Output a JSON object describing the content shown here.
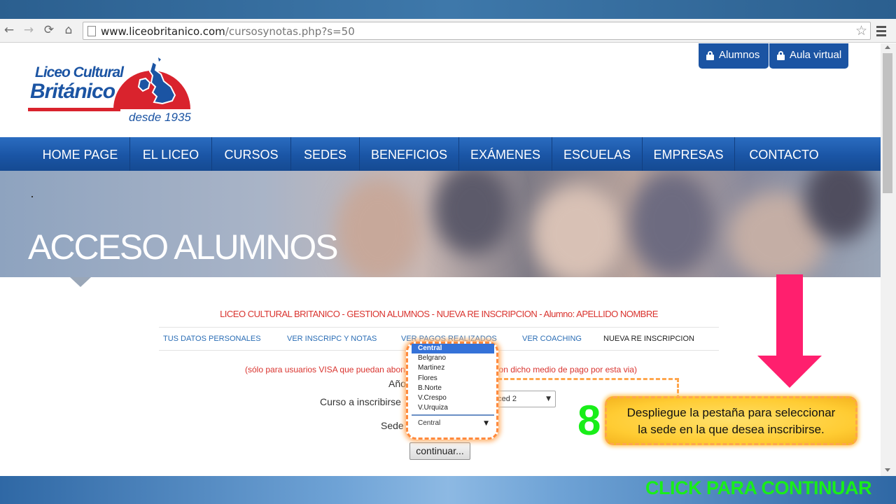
{
  "browser": {
    "url_domain": "www.liceobritanico.com",
    "url_path": "/cursosynotas.php?s=50",
    "back_icon": "←",
    "forward_icon": "→",
    "reload_icon": "⟳",
    "home_icon": "⌂",
    "star_icon": "☆"
  },
  "logo": {
    "line1": "Liceo Cultural",
    "line2": "Británico",
    "tagline": "desde 1935"
  },
  "top_buttons": {
    "students": "Alumnos",
    "virtual": "Aula virtual"
  },
  "nav": {
    "items": [
      "HOME PAGE",
      "EL LICEO",
      "CURSOS",
      "SEDES",
      "BENEFICIOS",
      "EXÁMENES",
      "ESCUELAS",
      "EMPRESAS",
      "CONTACTO"
    ]
  },
  "hero": {
    "dot": ".",
    "title": "ACCESO ALUMNOS"
  },
  "content": {
    "title": "LICEO CULTURAL BRITANICO - GESTION ALUMNOS - NUEVA RE INSCRIPCION - Alumno: APELLIDO NOMBRE",
    "tabs": [
      "TUS DATOS PERSONALES",
      "VER INSCRIPC Y NOTAS",
      "VER PAGOS REALIZADOS",
      "VER COACHING",
      "NUEVA RE INSCRIPCION"
    ],
    "notice_left": "(sólo para usuarios VISA que puedan abona",
    "notice_right": "on dicho medio de pago por esta via)",
    "year_label": "Año",
    "course_label": "Curso a inscribirse",
    "course_value": "nced 2",
    "branch_label": "Sede",
    "continue_button": "continuar..."
  },
  "dropdown": {
    "options": [
      "Central",
      "Belgrano",
      "Martinez",
      "Flores",
      "B.Norte",
      "V.Crespo",
      "V.Urquiza"
    ],
    "selected": "Central",
    "arrow": "▼"
  },
  "annotation": {
    "step_number": "8",
    "line1": "Despliegue la pestaña para seleccionar",
    "line2": "la sede en la que desea inscribirse.",
    "next": "CLICK PARA CONTINUAR"
  },
  "colors": {
    "brand_blue": "#1b54a3",
    "brand_red": "#d9232d",
    "step_green": "#19ee19",
    "arrow_pink": "#ff1f6e"
  }
}
